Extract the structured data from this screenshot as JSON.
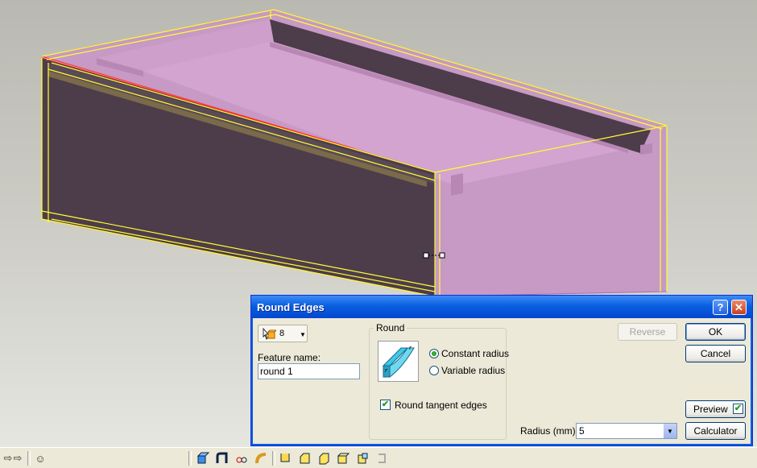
{
  "dialog": {
    "title": "Round Edges",
    "help_label": "?",
    "close_label": "✕",
    "selected_count": "8",
    "feature_name_label": "Feature name:",
    "feature_name_value": "round 1",
    "round_group_label": "Round",
    "constant_radius_label": "Constant radius",
    "variable_radius_label": "Variable radius",
    "round_tangent_label": "Round tangent edges",
    "round_tangent_checked": true,
    "radius_mode": "constant",
    "radius_label": "Radius (mm):",
    "radius_value": "5",
    "reverse_label": "Reverse",
    "ok_label": "OK",
    "cancel_label": "Cancel",
    "preview_label": "Preview",
    "preview_checked": true,
    "calculator_label": "Calculator"
  },
  "toolbar": {
    "smiley": "☺"
  },
  "colors": {
    "title_bar": "#0a5fe0",
    "model_face_pink": "#c799c5",
    "model_face_dark": "#4d3c4a",
    "edge_highlight": "#ffff33",
    "selection_edge": "#ff2a2a"
  }
}
